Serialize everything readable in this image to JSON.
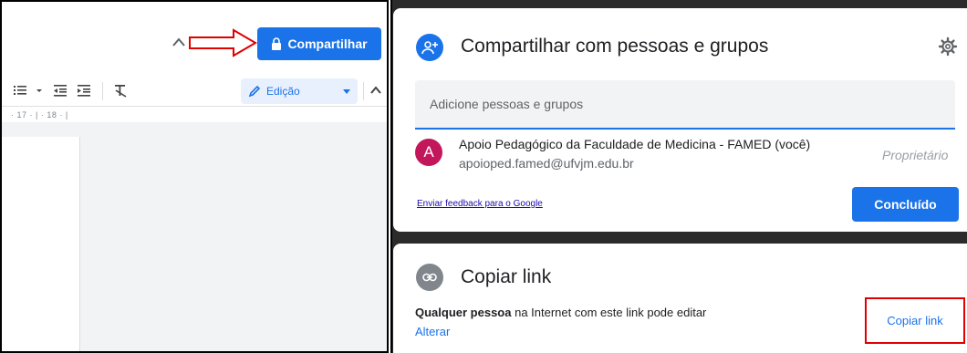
{
  "docs": {
    "share_button_label": "Compartilhar",
    "mode_label": "Edição",
    "ruler_text": "· 17 · | · 18 · |"
  },
  "share_dialog": {
    "title": "Compartilhar com pessoas e grupos",
    "input_placeholder": "Adicione pessoas e grupos",
    "owner": {
      "initial": "A",
      "name": "Apoio Pedagógico da Faculdade de Medicina - FAMED (você)",
      "email": "apoioped.famed@ufvjm.edu.br",
      "role": "Proprietário"
    },
    "feedback_link": "Enviar feedback para o Google",
    "done_button": "Concluído"
  },
  "copy_link_dialog": {
    "title": "Copiar link",
    "who": "Qualquer pessoa",
    "description_rest": " na Internet com este link pode editar",
    "change_link": "Alterar",
    "copy_button": "Copiar link"
  },
  "colors": {
    "accent_blue": "#1a73e8",
    "avatar_pink": "#c2185b",
    "annotation_red": "#e00000"
  },
  "icons": [
    "caret-up-icon",
    "lock-icon",
    "bullet-list-icon",
    "decrease-indent-icon",
    "increase-indent-icon",
    "clear-formatting-icon",
    "pencil-icon",
    "dropdown-arrow-icon",
    "collapse-toolbar-icon",
    "add-person-icon",
    "settings-gear-icon",
    "link-icon"
  ]
}
